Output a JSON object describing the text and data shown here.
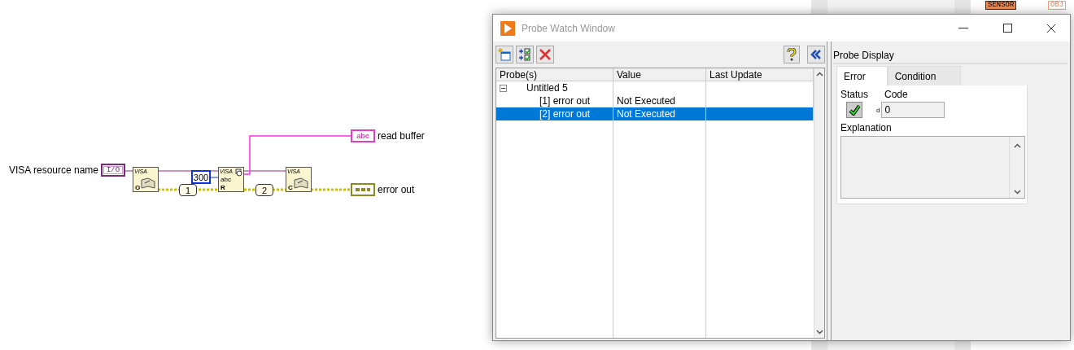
{
  "diagram": {
    "control": {
      "label": "VISA resource name",
      "glyph": "I/O"
    },
    "nodes": [
      {
        "kind": "open",
        "title": "VISA",
        "letter": "O"
      },
      {
        "kind": "read",
        "title": "VISA",
        "sub": "abc",
        "letter": "R"
      },
      {
        "kind": "close",
        "title": "VISA",
        "letter": "C"
      }
    ],
    "constant": "300",
    "probes": [
      "1",
      "2"
    ],
    "indicators": [
      {
        "kind": "string",
        "glyph": "abc",
        "label": "read buffer"
      },
      {
        "kind": "cluster",
        "label": "error out"
      }
    ]
  },
  "background_window": {
    "tags": [
      "SENSOR",
      "OBJ"
    ]
  },
  "probe_window": {
    "title": "Probe Watch Window",
    "columns": [
      "Probe(s)",
      "Value",
      "Last Update"
    ],
    "tree": [
      {
        "label": "Untitled 5",
        "expanded": true,
        "children": [
          {
            "label": "[1] error out",
            "value": "Not Executed",
            "selected": false
          },
          {
            "label": "[2] error out",
            "value": "Not Executed",
            "selected": true
          }
        ]
      }
    ],
    "display": {
      "title": "Probe Display",
      "tabs": [
        {
          "label": "Error",
          "selected": true
        },
        {
          "label": "Condition",
          "selected": false
        }
      ],
      "status_label": "Status",
      "status_ok": true,
      "code_label": "Code",
      "radix": "d",
      "code": "0",
      "explanation_label": "Explanation"
    }
  }
}
